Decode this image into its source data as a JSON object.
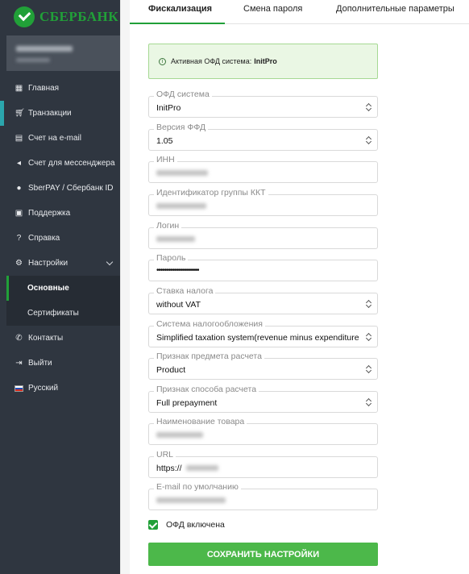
{
  "brand": {
    "name": "СБЕРБАНК",
    "color": "#21a038"
  },
  "sidebar": {
    "items": [
      {
        "label": "Главная",
        "icon": "dashboard-icon"
      },
      {
        "label": "Транзакции",
        "icon": "cart-icon"
      },
      {
        "label": "Счет на e-mail",
        "icon": "invoice-icon"
      },
      {
        "label": "Счет для мессенджера",
        "icon": "messenger-icon"
      },
      {
        "label": "SberPAY / Сбербанк ID",
        "icon": "sberpay-icon"
      },
      {
        "label": "Поддержка",
        "icon": "support-icon"
      },
      {
        "label": "Справка",
        "icon": "help-icon"
      },
      {
        "label": "Настройки",
        "icon": "gear-icon"
      },
      {
        "label": "Основные"
      },
      {
        "label": "Сертификаты"
      },
      {
        "label": "Контакты",
        "icon": "phone-icon"
      },
      {
        "label": "Выйти",
        "icon": "logout-icon"
      },
      {
        "label": "Русский",
        "icon": "russian-flag-icon"
      }
    ]
  },
  "tabs": [
    "Фискализация",
    "Смена пароля",
    "Дополнительные параметры"
  ],
  "alert": {
    "text": "Активная ОФД система:",
    "value": "InitPro"
  },
  "form": {
    "ofd_system": {
      "label": "ОФД система",
      "value": "InitPro"
    },
    "ffd_version": {
      "label": "Версия ФФД",
      "value": "1.05"
    },
    "inn": {
      "label": "ИНН"
    },
    "kkt_group": {
      "label": "Идентификатор группы ККТ"
    },
    "login": {
      "label": "Логин"
    },
    "password": {
      "label": "Пароль",
      "value": "•••••••••••••••••••••"
    },
    "tax_rate": {
      "label": "Ставка налога",
      "value": "without VAT"
    },
    "tax_system": {
      "label": "Система налогообложения",
      "value": "Simplified taxation system(revenue minus expenditure"
    },
    "payment_subject": {
      "label": "Признак предмета расчета",
      "value": "Product"
    },
    "payment_method": {
      "label": "Признак способа расчета",
      "value": "Full prepayment"
    },
    "product_name": {
      "label": "Наименование товара"
    },
    "url": {
      "label": "URL",
      "value": "https://"
    },
    "default_email": {
      "label": "E-mail по умолчанию"
    }
  },
  "ofd_enabled": {
    "label": "ОФД включена",
    "checked": true
  },
  "save_button": "СОХРАНИТЬ НАСТРОЙКИ"
}
